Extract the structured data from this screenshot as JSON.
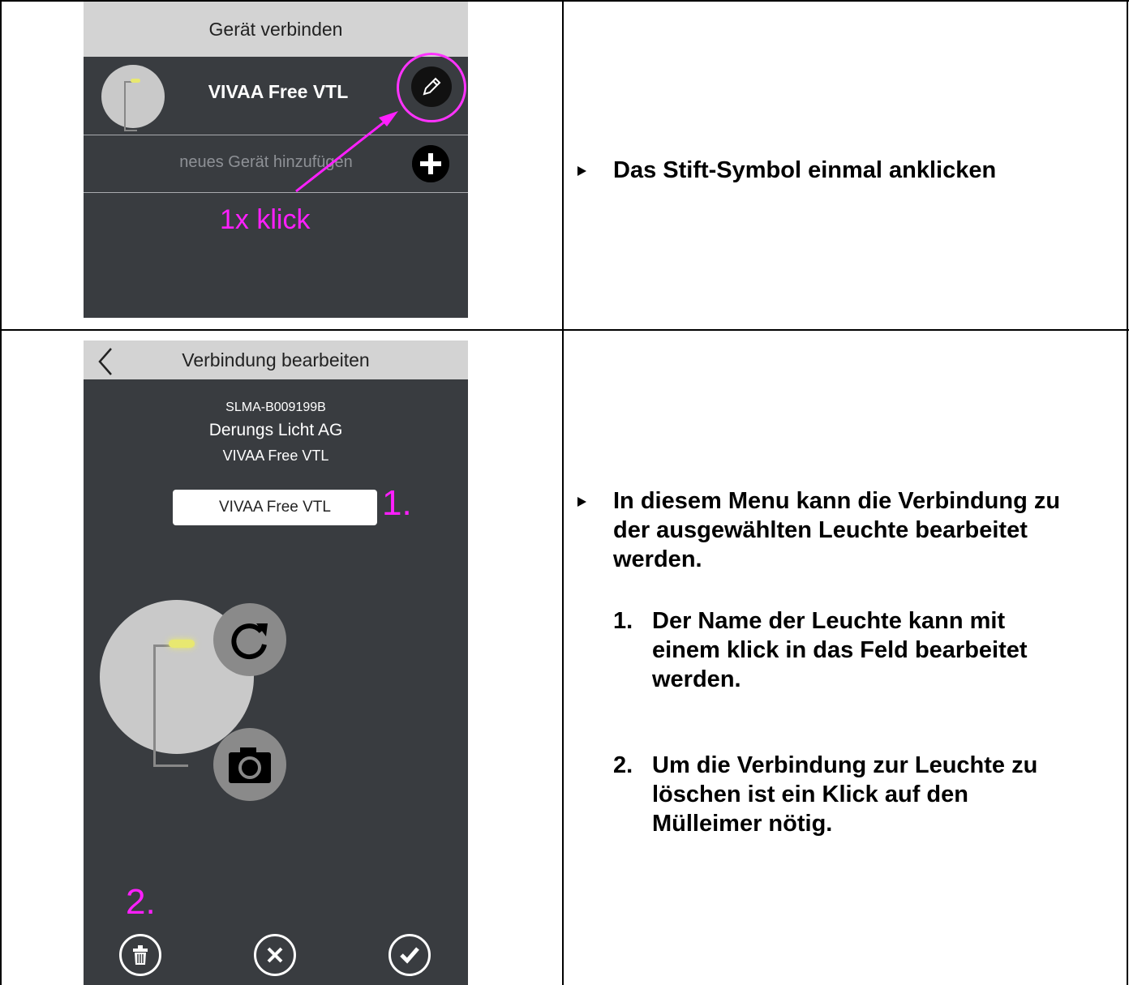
{
  "screen1": {
    "title": "Gerät verbinden",
    "device_name": "VIVAA Free VTL",
    "add_label": "neues Gerät hinzufügen",
    "annotation": "1x klick"
  },
  "step1": {
    "text": "Das Stift-Symbol einmal anklicken"
  },
  "screen2": {
    "title": "Verbindung bearbeiten",
    "device_id": "SLMA-B009199B",
    "manufacturer": "Derungs Licht AG",
    "model": "VIVAA Free VTL",
    "name_field_value": "VIVAA Free VTL",
    "annotation_1": "1.",
    "annotation_2": "2."
  },
  "step2": {
    "intro_line1": "In diesem Menu kann die Verbindung zu",
    "intro_line2": "der ausgewählten Leuchte bearbeitet",
    "intro_line3": "werden.",
    "items": [
      {
        "num": "1.",
        "line1": "Der Name der Leuchte kann mit",
        "line2": "einem klick in das Feld bearbeitet",
        "line3": "werden."
      },
      {
        "num": "2.",
        "line1": "Um die Verbindung zur Leuchte zu",
        "line2": "löschen ist ein Klick auf den",
        "line3": "Mülleimer nötig."
      }
    ]
  },
  "colors": {
    "annotation": "#ff1fff",
    "phone_bg": "#393c40",
    "appbar_bg": "#d3d3d3"
  },
  "icons": [
    "pencil-icon",
    "plus-icon",
    "back-chevron-icon",
    "refresh-icon",
    "camera-icon",
    "trash-icon",
    "close-icon",
    "check-icon"
  ]
}
